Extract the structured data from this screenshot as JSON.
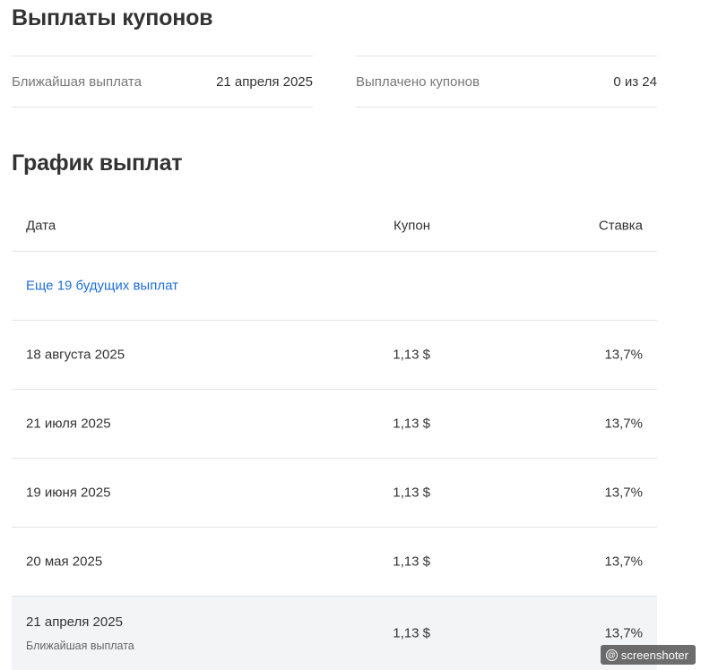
{
  "coupons": {
    "title": "Выплаты купонов",
    "summary": [
      {
        "label": "Ближайшая выплата",
        "value": "21 апреля 2025"
      },
      {
        "label": "Выплачено купонов",
        "value": "0 из 24"
      }
    ]
  },
  "schedule": {
    "title": "График выплат",
    "columns": {
      "date": "Дата",
      "coupon": "Купон",
      "rate": "Ставка"
    },
    "more_link": "Еще 19 будущих выплат",
    "rows": [
      {
        "date": "18 августа 2025",
        "coupon": "1,13 $",
        "rate": "13,7%"
      },
      {
        "date": "21 июля 2025",
        "coupon": "1,13 $",
        "rate": "13,7%"
      },
      {
        "date": "19 июня 2025",
        "coupon": "1,13 $",
        "rate": "13,7%"
      },
      {
        "date": "20 мая 2025",
        "coupon": "1,13 $",
        "rate": "13,7%"
      },
      {
        "date": "21 апреля 2025",
        "sub": "Ближайшая выплата",
        "coupon": "1,13 $",
        "rate": "13,7%"
      }
    ]
  },
  "watermark": {
    "icon": "at-icon",
    "text": "screenshoter"
  }
}
